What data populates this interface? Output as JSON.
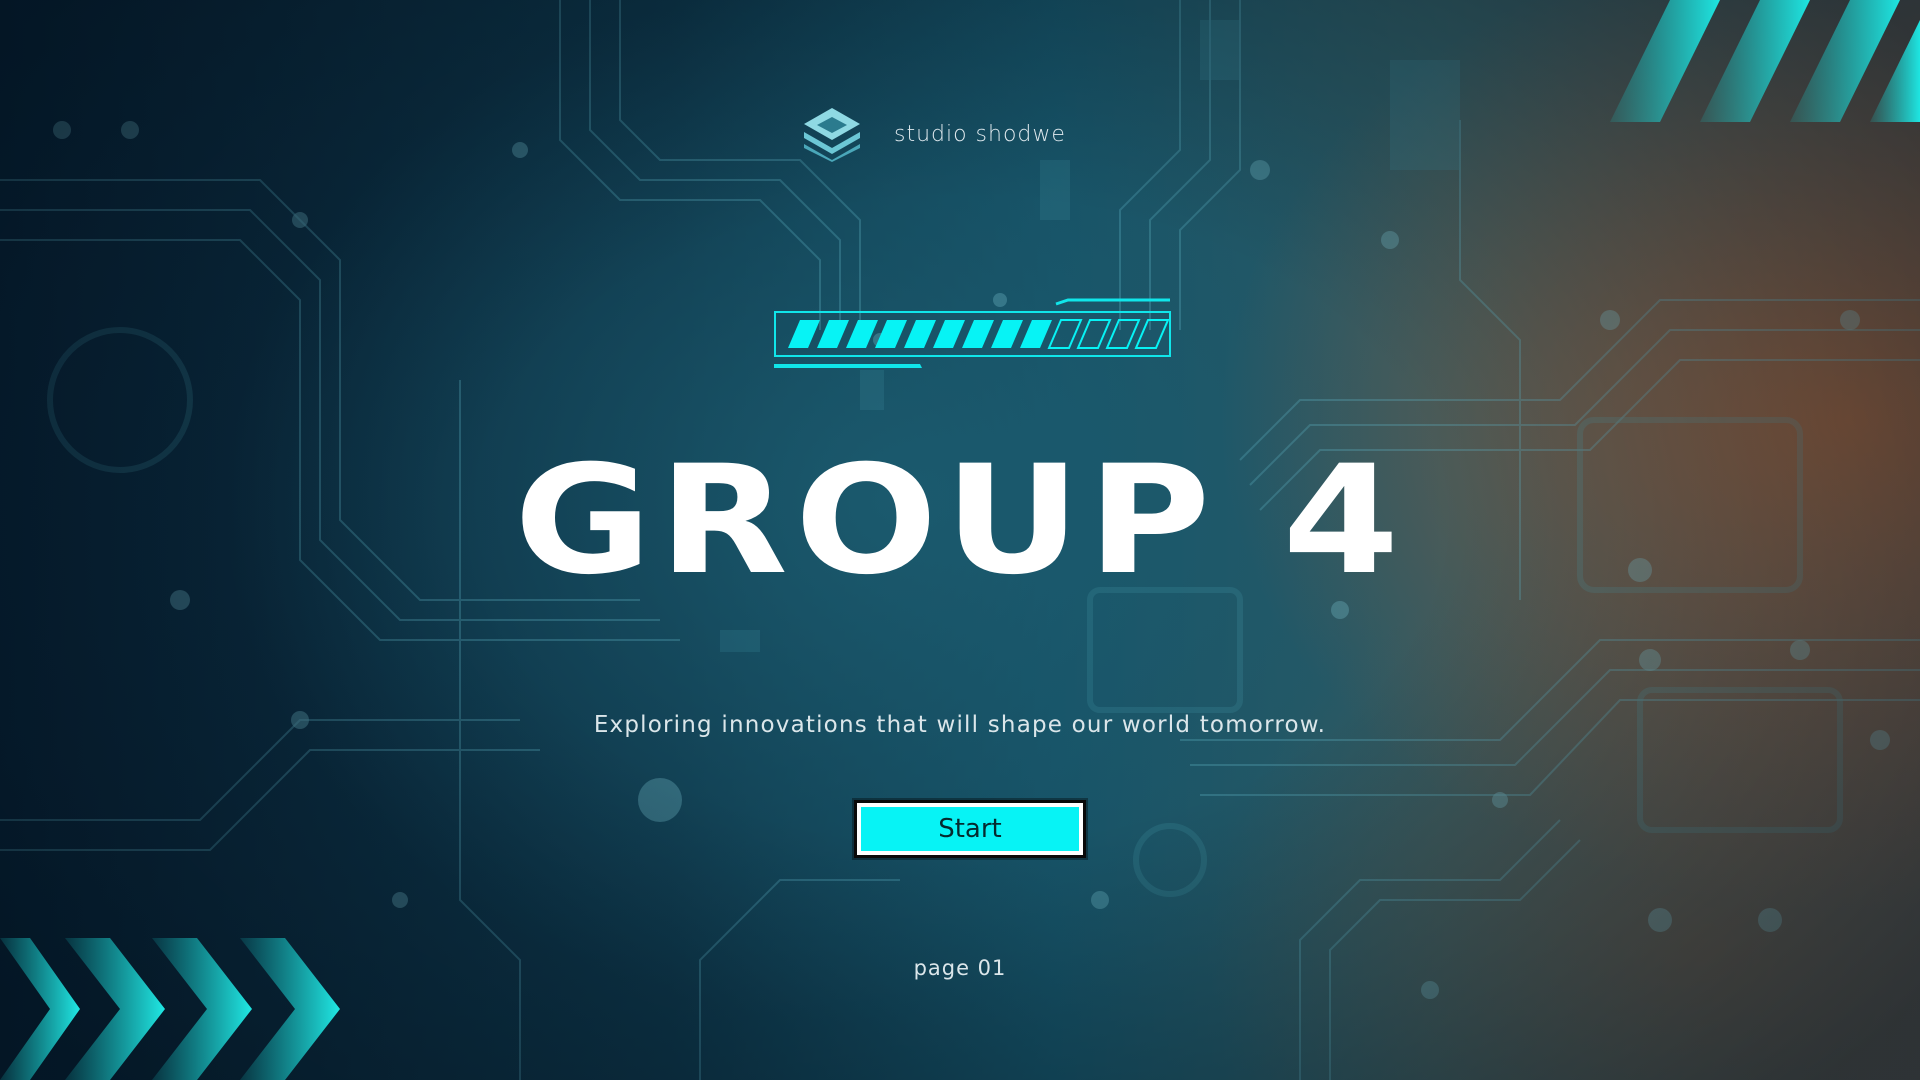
{
  "brand": {
    "name": "studio shodwe",
    "logo_icon": "stacked-layers-logo-icon"
  },
  "loader": {
    "progress": 0.7,
    "segments_filled": 9,
    "segments_total": 13
  },
  "hero": {
    "title": "GROUP 4",
    "subtitle": "Exploring innovations that will shape our world tomorrow."
  },
  "actions": {
    "start_label": "Start"
  },
  "footer": {
    "page_label": "page 01"
  },
  "colors": {
    "accent": "#07f3f5",
    "title": "#ffffff",
    "text": "#dbe6ea"
  },
  "icons": {
    "top_right": "chevron-stripes-icon",
    "bottom_left": "chevron-arrows-icon"
  }
}
